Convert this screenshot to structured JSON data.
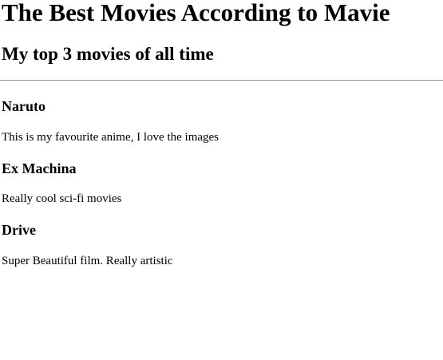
{
  "header": {
    "title": "The Best Movies According to Mavie",
    "subtitle": "My top 3 movies of all time"
  },
  "movies": [
    {
      "title": "Naruto",
      "description": "This is my favourite anime, I love the images"
    },
    {
      "title": "Ex Machina",
      "description": "Really cool sci-fi movies"
    },
    {
      "title": "Drive",
      "description": "Super Beautiful film. Really artistic"
    }
  ]
}
